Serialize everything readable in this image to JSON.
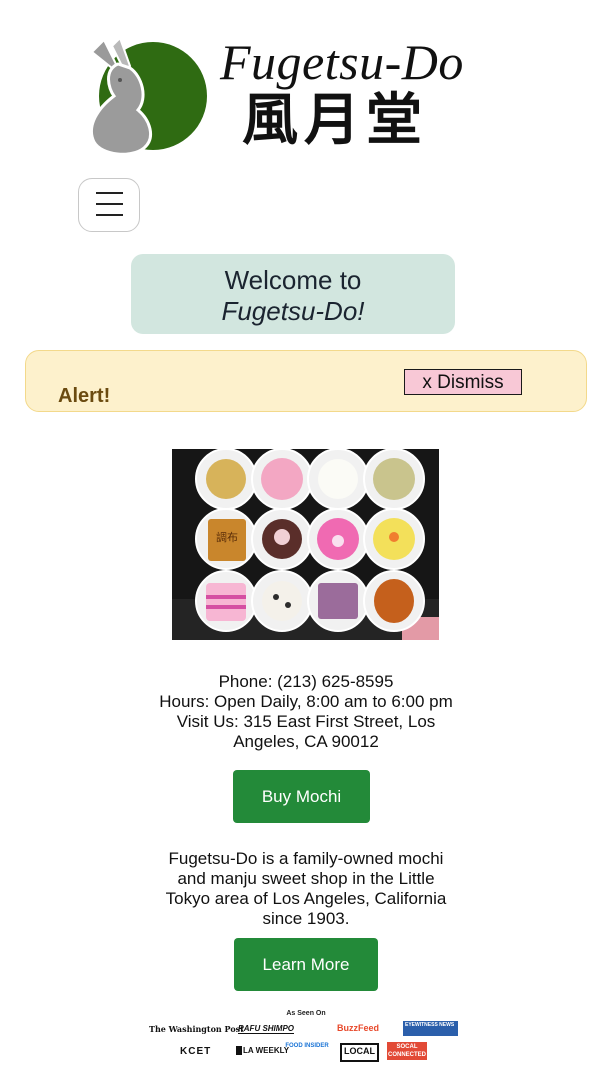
{
  "brand": {
    "name": "Fugetsu-Do",
    "kanji": "風月堂"
  },
  "menu": {
    "icon": "hamburger-menu-icon"
  },
  "welcome": {
    "line1": "Welcome to",
    "line2": "Fugetsu-Do!"
  },
  "alert": {
    "label": "Alert!",
    "dismiss_label": "x Dismiss"
  },
  "photo": {
    "kanji_on_sweet": "調布"
  },
  "contact": {
    "phone": "Phone: (213) 625-8595",
    "hours": "Hours: Open Daily, 8:00 am to 6:00 pm",
    "address_line1": "Visit Us: 315 East First Street, Los",
    "address_line2": "Angeles, CA 90012"
  },
  "buttons": {
    "buy": "Buy Mochi",
    "learn": "Learn More"
  },
  "about": [
    "Fugetsu-Do is a family-owned mochi",
    "and manju sweet shop in the Little",
    "Tokyo area of Los Angeles, California",
    "since 1903."
  ],
  "press": {
    "heading": "As Seen On",
    "outlets": [
      "The Washington Post",
      "RAFU SHIMPO",
      "BuzzFeed",
      "EYEWITNESS NEWS",
      "KCET",
      "LA WEEKLY",
      "FOOD INSIDER",
      "LOCAL",
      "SOCAL CONNECTED"
    ]
  },
  "colors": {
    "accent_green": "#238a39",
    "welcome_bg": "#d2e6df",
    "alert_bg": "#fdf1cc",
    "dismiss_bg": "#f8c8d6"
  }
}
